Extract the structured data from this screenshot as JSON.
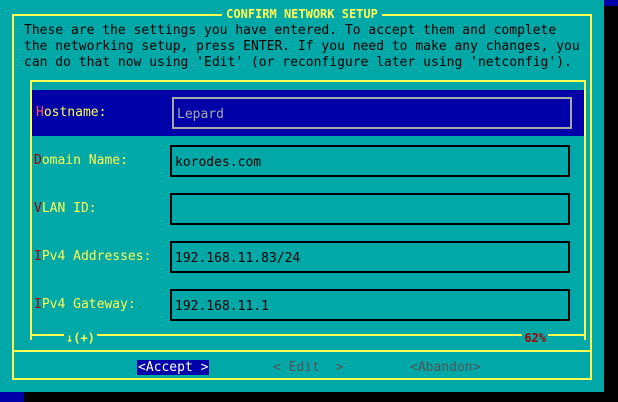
{
  "dialog": {
    "title": "CONFIRM NETWORK SETUP",
    "message": "These are the settings you have entered. To accept them and complete\nthe networking setup, press ENTER. If you need to make any changes, you\ncan do that now using 'Edit' (or reconfigure later using 'netconfig')."
  },
  "fields": [
    {
      "hotkey": "H",
      "label_rest": "ostname:",
      "value": "Lepard"
    },
    {
      "hotkey": "D",
      "label_rest": "omain Name:",
      "value": "korodes.com"
    },
    {
      "hotkey": "V",
      "label_rest": "LAN ID:",
      "value": ""
    },
    {
      "hotkey": "I",
      "label_rest": "Pv4 Addresses:",
      "value": "192.168.11.83/24"
    },
    {
      "hotkey": "I",
      "label_rest": "Pv4 Gateway:",
      "value": "192.168.11.1"
    }
  ],
  "scroll": {
    "more_indicator": "↓(+)",
    "percent": "62%"
  },
  "buttons": {
    "accept": "<Accept >",
    "edit": "< Edit  >",
    "abandon": "<Abandon>"
  },
  "colors": {
    "dialog_bg": "#00a8a8",
    "screen_bg": "#0000a8",
    "frame": "#ffff54",
    "label": "#ffff54",
    "hotkey": "#a80000",
    "selected_bg": "#0000a8",
    "disabled": "#545454"
  }
}
